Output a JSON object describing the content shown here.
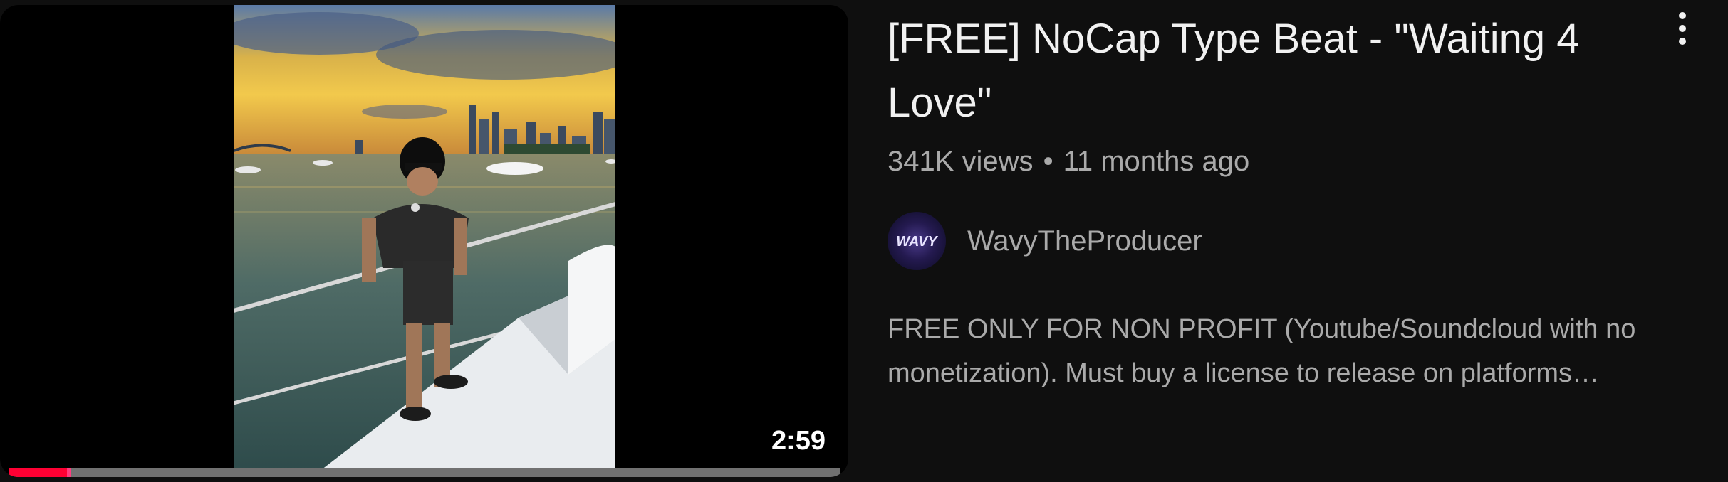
{
  "video": {
    "title": "[FREE] NoCap Type Beat - \"Waiting 4 Love\"",
    "duration": "2:59",
    "progress_fraction": 0.07,
    "views": "341K views",
    "separator": "•",
    "age": "11 months ago",
    "channel": {
      "name": "WavyTheProducer",
      "avatar_text": "WAVY"
    },
    "description_lines": [
      "FREE ONLY FOR NON PROFIT (Youtube/Soundcloud with no",
      "monetization). Must buy a license to release on platforms…"
    ],
    "more_icon": "vertical-ellipsis-icon"
  },
  "colors": {
    "background": "#0f0f0f",
    "title": "#f1f1f1",
    "secondary_text": "#aaaaaa",
    "progress": "#ff0033"
  }
}
